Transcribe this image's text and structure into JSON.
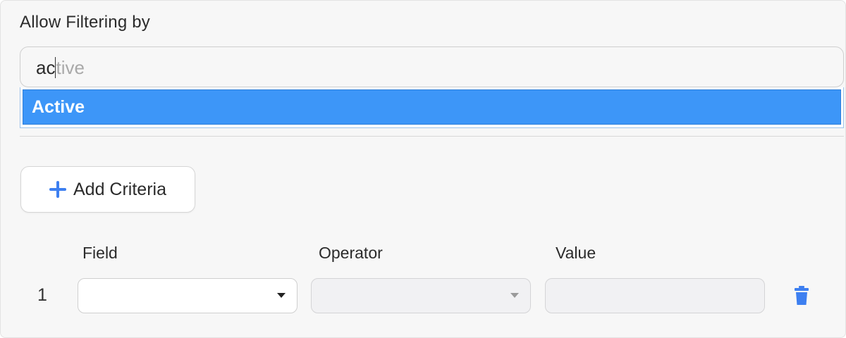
{
  "filter": {
    "section_label": "Allow Filtering by",
    "search_typed": "ac",
    "search_completion": "tive",
    "dropdown_options": [
      "Active"
    ]
  },
  "criteria": {
    "add_button_label": "Add Criteria",
    "columns": [
      "Field",
      "Operator",
      "Value"
    ],
    "rows": [
      {
        "index": "1",
        "field": "",
        "operator": "",
        "value": ""
      }
    ]
  },
  "icons": {
    "add": "plus-icon",
    "field_dropdown": "chevron-down-icon",
    "operator_dropdown": "chevron-down-icon",
    "delete": "trash-icon"
  },
  "colors": {
    "accent": "#3d96f8",
    "icon_blue": "#3d7ff0"
  }
}
